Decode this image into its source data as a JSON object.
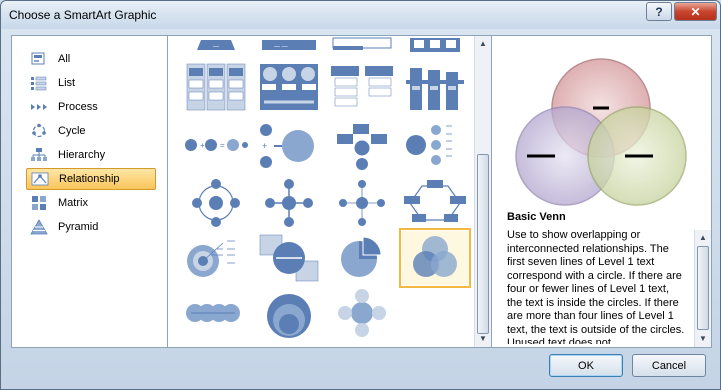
{
  "window": {
    "title": "Choose a SmartArt Graphic",
    "help_label": "?",
    "close_label": "✕"
  },
  "categories": [
    {
      "label": "All",
      "icon": "all-icon"
    },
    {
      "label": "List",
      "icon": "list-icon"
    },
    {
      "label": "Process",
      "icon": "process-icon"
    },
    {
      "label": "Cycle",
      "icon": "cycle-icon"
    },
    {
      "label": "Hierarchy",
      "icon": "hierarchy-icon"
    },
    {
      "label": "Relationship",
      "icon": "relationship-icon",
      "selected": true
    },
    {
      "label": "Matrix",
      "icon": "matrix-icon"
    },
    {
      "label": "Pyramid",
      "icon": "pyramid-icon"
    }
  ],
  "gallery": {
    "selected": "basic-venn",
    "items": [
      "partial-1",
      "partial-2",
      "partial-3",
      "partial-4",
      "grouped-list",
      "opposing-ideas",
      "table-list",
      "stacked-list",
      "equation",
      "converging-radial",
      "radial-list",
      "target-list",
      "radial-cycle",
      "diverging-radial",
      "basic-radial",
      "cycle-matrix",
      "target",
      "counterbalance-arrows",
      "pie-segments",
      "basic-venn",
      "linear-venn",
      "stacked-venn",
      "radial-venn"
    ]
  },
  "details": {
    "title": "Basic Venn",
    "description": "Use to show overlapping or interconnected relationships. The first seven lines of Level 1 text correspond with a circle. If there are four or fewer lines of Level 1 text, the text is inside the circles. If there are more than four lines of Level 1 text, the text is outside of the circles. Unused text does not"
  },
  "buttons": {
    "ok": "OK",
    "cancel": "Cancel"
  },
  "colors": {
    "accent": "#f4b73f",
    "diagram_blue": "#5b7fb5"
  }
}
